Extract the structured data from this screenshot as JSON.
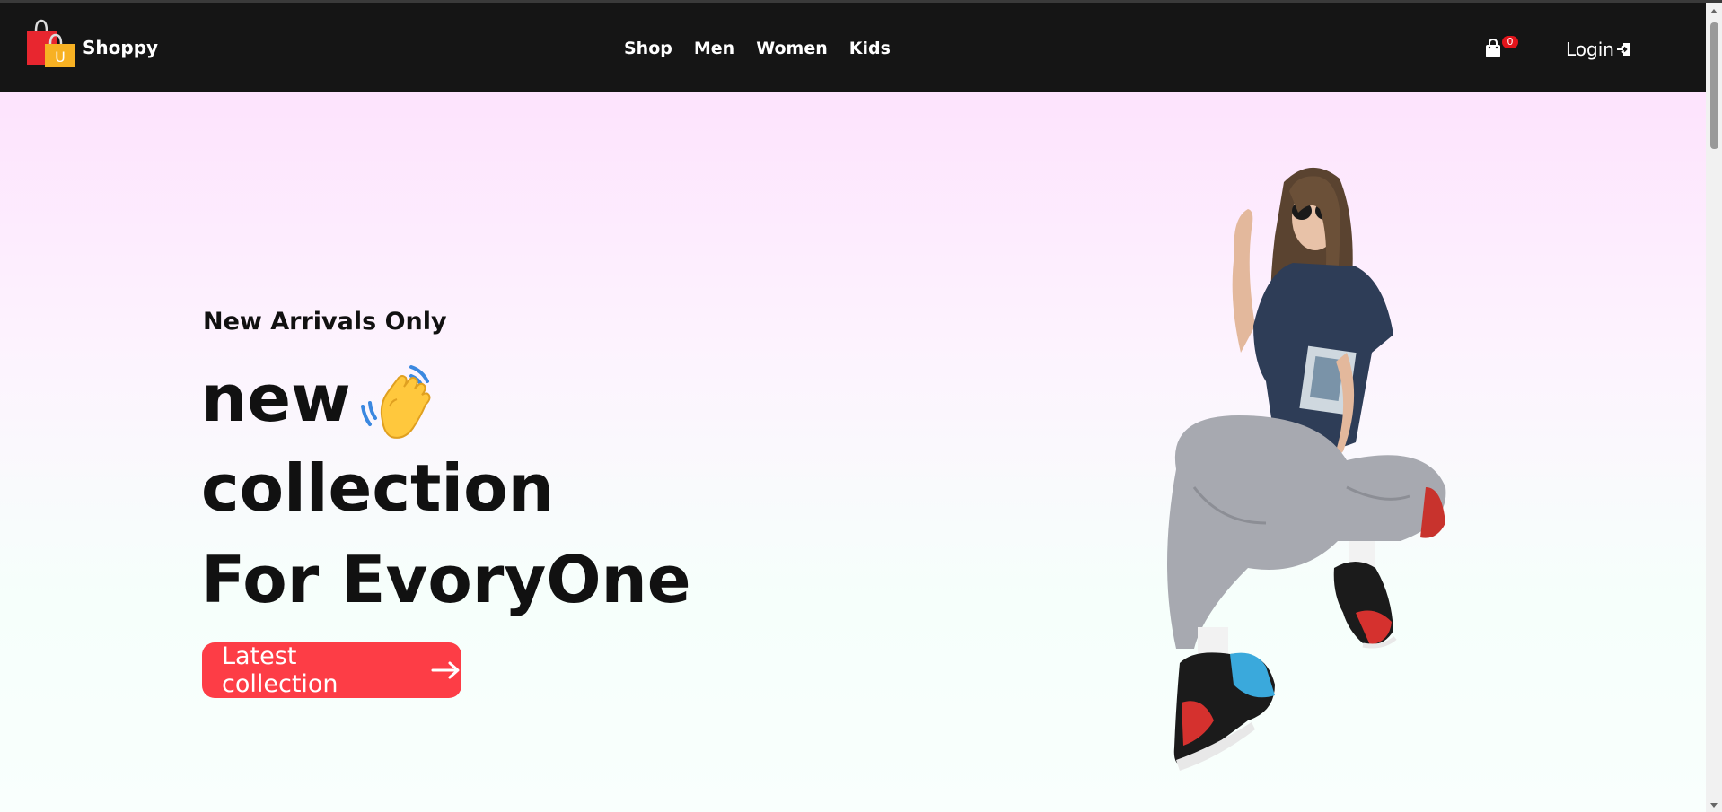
{
  "brand": {
    "name": "Shoppy",
    "logo_letter": "U"
  },
  "nav": {
    "links": [
      "Shop",
      "Men",
      "Women",
      "Kids"
    ]
  },
  "cart": {
    "count": "0",
    "icon": "shopping-bag-icon"
  },
  "login": {
    "label": "Login",
    "icon": "sign-in-icon"
  },
  "hero": {
    "tagline": "New Arrivals Only",
    "line1": "new",
    "line2": "collection",
    "line3": "For EvoryOne",
    "emoji": "👋",
    "cta_label": "Latest collection",
    "cta_icon": "arrow-right-icon"
  },
  "colors": {
    "navbar_bg": "#151515",
    "accent": "#fd3d46",
    "badge": "#e3141b",
    "hero_top": "#fde3fd",
    "hero_bottom": "#f6fffb"
  }
}
